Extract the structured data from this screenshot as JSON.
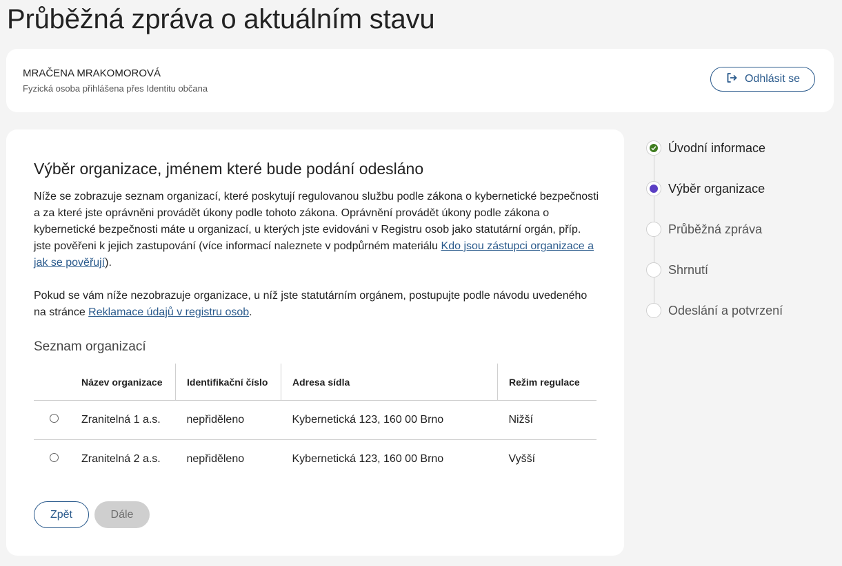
{
  "page": {
    "title": "Průběžná zpráva o aktuálním stavu"
  },
  "user": {
    "name": "MRAČENA MRAKOMOROVÁ",
    "subtitle": "Fyzická osoba přihlášena přes Identitu občana",
    "logout_label": "Odhlásit se",
    "logout_icon": "logout-icon"
  },
  "main": {
    "heading": "Výběr organizace, jménem které bude podání odesláno",
    "intro_p1": "Níže se zobrazuje seznam organizací, které poskytují regulovanou službu podle zákona o kybernetické bezpečnosti a za které jste oprávněni provádět úkony podle tohoto zákona. Oprávnění provádět úkony podle zákona o kybernetické bezpečnosti máte u organizací, u kterých jste evidováni v Registru osob jako statutární orgán, příp. jste pověřeni k jejich zastupování (více informací naleznete v podpůrném materiálu ",
    "intro_p1_link": "Kdo jsou zástupci organizace a jak se pověřují",
    "intro_p1_end": ").",
    "intro_p2": "Pokud se vám níže nezobrazuje organizace, u níž jste statutárním orgánem, postupujte podle návodu uvedeného na stránce ",
    "intro_p2_link": "Reklamace údajů v registru osob",
    "intro_p2_end": ".",
    "list_heading": "Seznam organizací",
    "table": {
      "headers": [
        "Název organizace",
        "Identifikační číslo",
        "Adresa sídla",
        "Režim regulace"
      ],
      "rows": [
        [
          "Zranitelná 1 a.s.",
          "nepřiděleno",
          "Kybernetická 123, 160 00 Brno",
          "Nižší"
        ],
        [
          "Zranitelná 2 a.s.",
          "nepřiděleno",
          "Kybernetická 123, 160 00 Brno",
          "Vyšší"
        ]
      ]
    },
    "back_label": "Zpět",
    "next_label": "Dále"
  },
  "stepper": {
    "steps": [
      {
        "label": "Úvodní informace",
        "state": "done"
      },
      {
        "label": "Výběr organizace",
        "state": "active"
      },
      {
        "label": "Průběžná zpráva",
        "state": "upcoming"
      },
      {
        "label": "Shrnutí",
        "state": "upcoming"
      },
      {
        "label": "Odeslání a potvrzení",
        "state": "upcoming"
      }
    ]
  },
  "colors": {
    "accent": "#2a5a8c",
    "done": "#3f7d1f",
    "active": "#5b3fc4"
  }
}
